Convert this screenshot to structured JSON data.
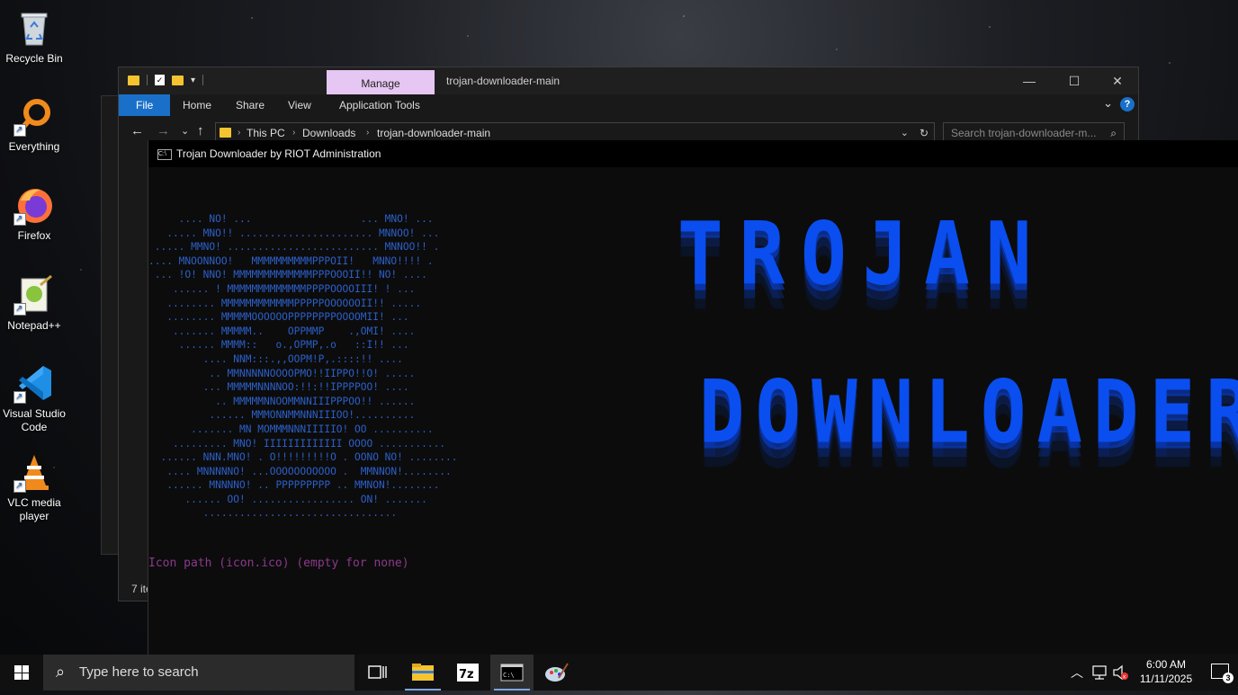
{
  "desktop": {
    "icons": [
      {
        "label": "Recycle Bin"
      },
      {
        "label": "Everything"
      },
      {
        "label": "Firefox"
      },
      {
        "label": "Notepad++"
      },
      {
        "label": "Visual Studio Code"
      },
      {
        "label": "VLC media player"
      }
    ]
  },
  "explorer": {
    "manage_tab": "Manage",
    "title": "trojan-downloader-main",
    "ribbon": {
      "file": "File",
      "home": "Home",
      "share": "Share",
      "view": "View",
      "app_tools": "Application Tools"
    },
    "breadcrumb": [
      "This PC",
      "Downloads",
      "trojan-downloader-main"
    ],
    "search_placeholder": "Search trojan-downloader-m...",
    "status": "7 ite"
  },
  "console": {
    "title": "Trojan Downloader by RIOT Administration",
    "ascii_art": "     .... NO! ...                  ... MNO! ...\n   ..... MNO!! ...................... MNNOO! ...\n ..... MMNO! ......................... MNNOO!! .\n.... MNOONNOO!   MMMMMMMMMMPPPOII!   MNNO!!!! .\n ... !O! NNO! MMMMMMMMMMMMMPPPOOOII!! NO! ....\n    ...... ! MMMMMMMMMMMMMPPPPOOOOIII! ! ...\n   ........ MMMMMMMMMMMMPPPPPOOOOOOII!! .....\n   ........ MMMMMOOOOOOPPPPPPPPOOOOMII! ...\n    ....... MMMMM..    OPPMMP    .,OMI! ....\n     ...... MMMM::   o.,OPMP,.o   ::I!! ...\n         .... NNM:::.,,OOPM!P,.::::!! ....\n          .. MMNNNNNOOOOPMO!!IIPPO!!O! .....\n         ... MMMMMNNNNOO:!!:!!IPPPPOO! ....\n           .. MMMMMNNOOMMNNIIIPPPOO!! ......\n          ...... MMMONNMMNNNIIIOO!..........\n       ....... MN MOMMMNNNIIIIIO! OO ..........\n    ......... MNO! IIIIIIIIIIIII OOOO ...........\n  ...... NNN.MNO! . O!!!!!!!!!O . OONO NO! ........\n   .... MNNNNNO! ...OOOOOOOOOOO .  MMNNON!........\n   ...... MNNNNO! .. PPPPPPPPP .. MMNON!........\n      ...... OO! ................. ON! .......\n         ................................",
    "banner_line1": "TROJAN",
    "banner_line2": "DOWNLOADER",
    "prompt": "Icon path (icon.ico) (empty for none)"
  },
  "taskbar": {
    "search_placeholder": "Type here to search",
    "time": "6:00 AM",
    "date": "11/11/2025",
    "notification_count": "3"
  },
  "colors": {
    "accent": "#1a70c8",
    "banner": "#0a4ef0",
    "ascii": "#2c5fc8",
    "prompt": "#8b3a8c",
    "manage_tab": "#e6c6f2"
  }
}
